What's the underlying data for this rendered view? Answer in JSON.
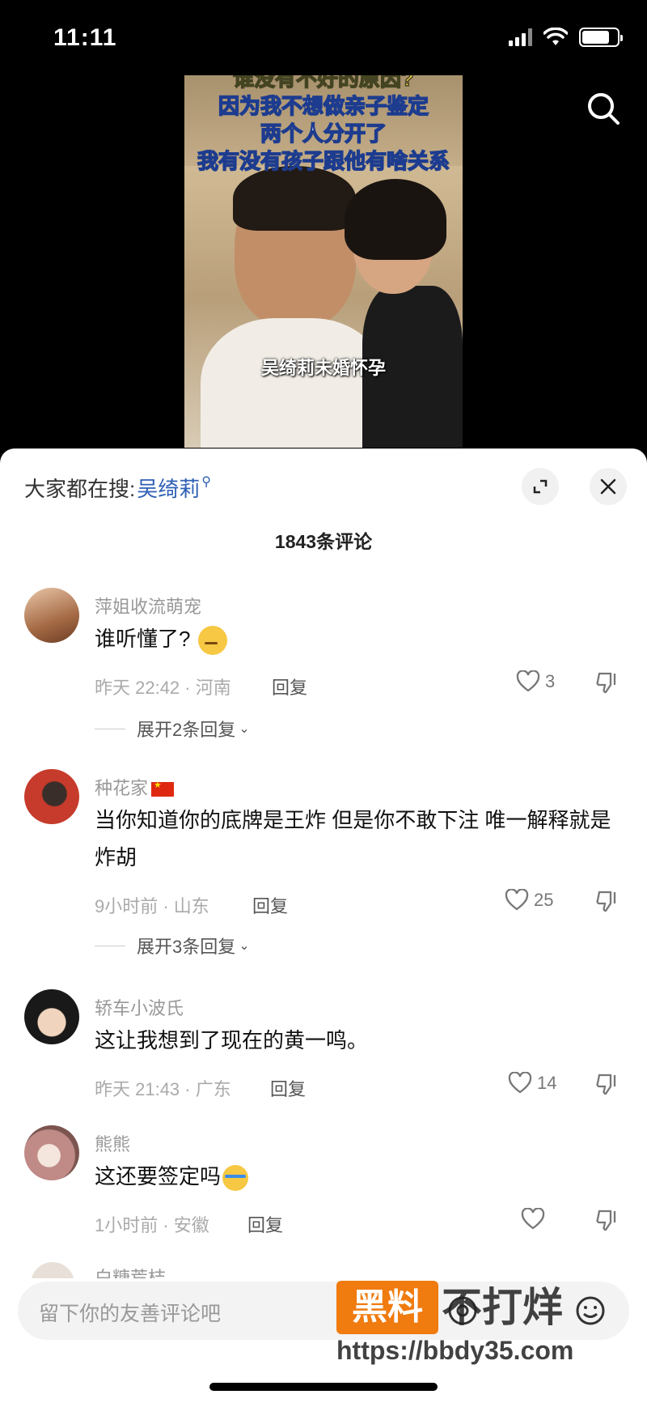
{
  "status_bar": {
    "time": "11:11"
  },
  "video": {
    "captions": [
      "谁没有不好的原因?",
      "因为我不想做亲子鉴定",
      "两个人分开了",
      "我有没有孩子跟他有啥关系"
    ],
    "subtitle": "吴绮莉未婚怀孕"
  },
  "panel": {
    "hot_search_label": "大家都在搜:",
    "hot_search_term": "吴绮莉",
    "comment_count": "1843条评论"
  },
  "comments": [
    {
      "name": "萍姐收流萌宠",
      "text": "谁听懂了?",
      "time": "昨天 22:42 · 河南",
      "reply": "回复",
      "likes": "3",
      "expand": "展开2条回复"
    },
    {
      "name": "种花家",
      "text": "当你知道你的底牌是王炸  但是你不敢下注  唯一解释就是炸胡",
      "time": "9小时前 · 山东",
      "reply": "回复",
      "likes": "25",
      "expand": "展开3条回复"
    },
    {
      "name": "轿车小波氏",
      "text": "这让我想到了现在的黄一鸣。",
      "time": "昨天 21:43 · 广东",
      "reply": "回复",
      "likes": "14"
    },
    {
      "name": "熊熊",
      "text": "这还要签定吗",
      "time": "1小时前 · 安徽",
      "reply": "回复",
      "likes": ""
    },
    {
      "name": "白糖荒桔"
    }
  ],
  "input": {
    "placeholder": "留下你的友善评论吧"
  },
  "watermark": {
    "box": "黑料",
    "text": "不打烊",
    "url": "https://bbdy35.com"
  },
  "colors": {
    "accent_link": "#2d5fb4",
    "watermark_orange": "#f07b0f"
  }
}
